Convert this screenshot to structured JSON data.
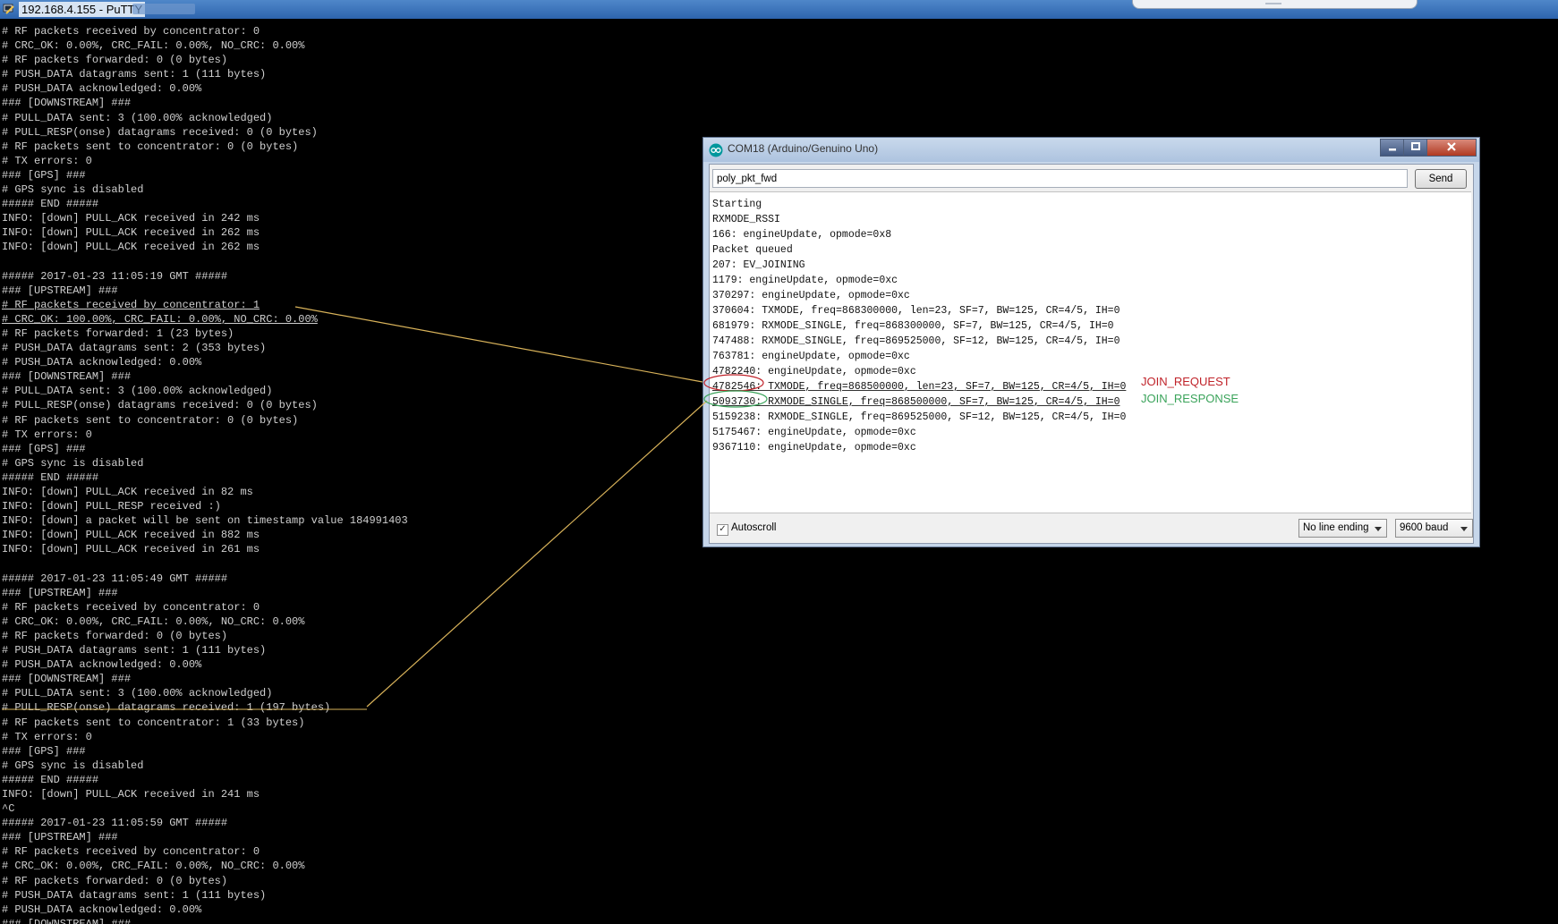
{
  "putty": {
    "title": "192.168.4.155 - PuTTY",
    "lines": [
      "# RF packets received by concentrator: 0",
      "# CRC_OK: 0.00%, CRC_FAIL: 0.00%, NO_CRC: 0.00%",
      "# RF packets forwarded: 0 (0 bytes)",
      "# PUSH_DATA datagrams sent: 1 (111 bytes)",
      "# PUSH_DATA acknowledged: 0.00%",
      "### [DOWNSTREAM] ###",
      "# PULL_DATA sent: 3 (100.00% acknowledged)",
      "# PULL_RESP(onse) datagrams received: 0 (0 bytes)",
      "# RF packets sent to concentrator: 0 (0 bytes)",
      "# TX errors: 0",
      "### [GPS] ###",
      "# GPS sync is disabled",
      "##### END #####",
      "INFO: [down] PULL_ACK received in 242 ms",
      "INFO: [down] PULL_ACK received in 262 ms",
      "INFO: [down] PULL_ACK received in 262 ms",
      "",
      "##### 2017-01-23 11:05:19 GMT #####",
      "### [UPSTREAM] ###",
      "# RF packets received by concentrator: 1",
      "# CRC_OK: 100.00%, CRC_FAIL: 0.00%, NO_CRC: 0.00%",
      "# RF packets forwarded: 1 (23 bytes)",
      "# PUSH_DATA datagrams sent: 2 (353 bytes)",
      "# PUSH_DATA acknowledged: 0.00%",
      "### [DOWNSTREAM] ###",
      "# PULL_DATA sent: 3 (100.00% acknowledged)",
      "# PULL_RESP(onse) datagrams received: 0 (0 bytes)",
      "# RF packets sent to concentrator: 0 (0 bytes)",
      "# TX errors: 0",
      "### [GPS] ###",
      "# GPS sync is disabled",
      "##### END #####",
      "INFO: [down] PULL_ACK received in 82 ms",
      "INFO: [down] PULL_RESP received :)",
      "INFO: [down] a packet will be sent on timestamp value 184991403",
      "INFO: [down] PULL_ACK received in 882 ms",
      "INFO: [down] PULL_ACK received in 261 ms",
      "",
      "##### 2017-01-23 11:05:49 GMT #####",
      "### [UPSTREAM] ###",
      "# RF packets received by concentrator: 0",
      "# CRC_OK: 0.00%, CRC_FAIL: 0.00%, NO_CRC: 0.00%",
      "# RF packets forwarded: 0 (0 bytes)",
      "# PUSH_DATA datagrams sent: 1 (111 bytes)",
      "# PUSH_DATA acknowledged: 0.00%",
      "### [DOWNSTREAM] ###",
      "# PULL_DATA sent: 3 (100.00% acknowledged)",
      "# PULL_RESP(onse) datagrams received: 1 (197 bytes)",
      "# RF packets sent to concentrator: 1 (33 bytes)",
      "# TX errors: 0",
      "### [GPS] ###",
      "# GPS sync is disabled",
      "##### END #####",
      "INFO: [down] PULL_ACK received in 241 ms",
      "^C",
      "##### 2017-01-23 11:05:59 GMT #####",
      "### [UPSTREAM] ###",
      "# RF packets received by concentrator: 0",
      "# CRC_OK: 0.00%, CRC_FAIL: 0.00%, NO_CRC: 0.00%",
      "# RF packets forwarded: 0 (0 bytes)",
      "# PUSH_DATA datagrams sent: 1 (111 bytes)",
      "# PUSH_DATA acknowledged: 0.00%",
      "### [DOWNSTREAM] ###"
    ]
  },
  "serial_monitor": {
    "title": "COM18 (Arduino/Genuino Uno)",
    "input_value": "poly_pkt_fwd",
    "send_label": "Send",
    "output": [
      "Starting",
      "RXMODE_RSSI",
      "166: engineUpdate, opmode=0x8",
      "Packet queued",
      "207: EV_JOINING",
      "1179: engineUpdate, opmode=0xc",
      "370297: engineUpdate, opmode=0xc",
      "370604: TXMODE, freq=868300000, len=23, SF=7, BW=125, CR=4/5, IH=0",
      "681979: RXMODE_SINGLE, freq=868300000, SF=7, BW=125, CR=4/5, IH=0",
      "747488: RXMODE_SINGLE, freq=869525000, SF=12, BW=125, CR=4/5, IH=0",
      "763781: engineUpdate, opmode=0xc",
      "4782240: engineUpdate, opmode=0xc",
      "4782546: TXMODE, freq=868500000, len=23, SF=7, BW=125, CR=4/5, IH=0",
      "5093730: RXMODE_SINGLE, freq=868500000, SF=7, BW=125, CR=4/5, IH=0",
      "5159238: RXMODE_SINGLE, freq=869525000, SF=12, BW=125, CR=4/5, IH=0",
      "5175467: engineUpdate, opmode=0xc",
      "9367110: engineUpdate, opmode=0xc"
    ],
    "autoscroll_label": "Autoscroll",
    "line_ending": "No line ending",
    "baud": "9600 baud"
  },
  "annotations": {
    "join_request": "JOIN_REQUEST",
    "join_response": "JOIN_RESPONSE",
    "colors": {
      "request": "#c0232a",
      "response": "#3aa35a",
      "connector": "#d9b35a"
    }
  }
}
